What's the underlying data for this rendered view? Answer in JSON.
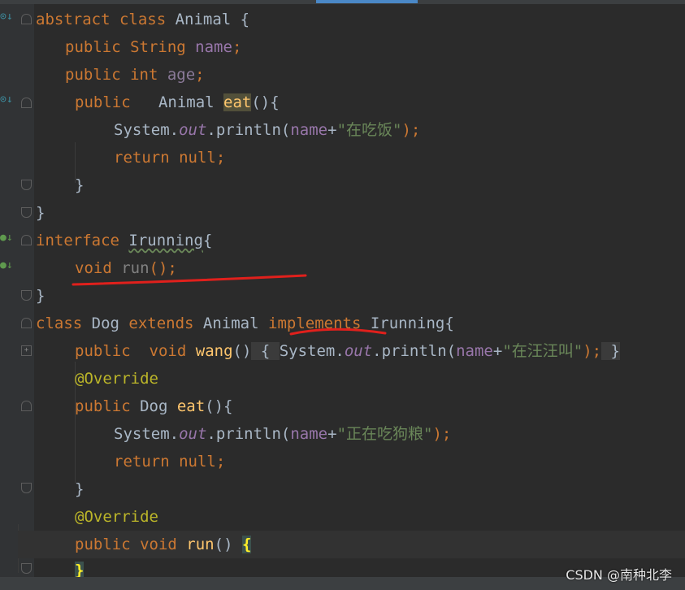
{
  "editor": {
    "lines": {
      "l1": [
        "abstract class",
        " Animal {"
      ],
      "l2": [
        "public String",
        " ",
        "name",
        ";"
      ],
      "l3": [
        "public int",
        " ",
        "age",
        ";"
      ],
      "l4": [
        "public",
        "   Animal ",
        "eat",
        "(){"
      ],
      "l5": [
        "System.",
        "out",
        ".println(",
        "name",
        "+",
        "\"在吃饭\"",
        ");"
      ],
      "l6": [
        "return null",
        ";"
      ],
      "l7": [
        "}"
      ],
      "l8": [
        "}"
      ],
      "l9": [
        "interface",
        " ",
        "Irunning",
        "{"
      ],
      "l10": [
        "void",
        " ",
        "run",
        "();"
      ],
      "l11": [
        "}"
      ],
      "l12": [
        "class",
        " Dog ",
        "extends",
        " Animal ",
        "implements",
        " Irunning{"
      ],
      "l13": [
        "public",
        "  ",
        "void",
        " ",
        "wang",
        "()",
        " { ",
        "System.",
        "out",
        ".println(",
        "name",
        "+",
        "\"在汪汪叫\"",
        ");",
        " }"
      ],
      "l14": [
        "@Override"
      ],
      "l15": [
        "public",
        " Dog ",
        "eat",
        "(){"
      ],
      "l16": [
        "System.",
        "out",
        ".println(",
        "name",
        "+",
        "\"正在吃狗粮\"",
        ");"
      ],
      "l17": [
        "return null",
        ";"
      ],
      "l18": [
        "}"
      ],
      "l19": [
        "@Override"
      ],
      "l20": [
        "public void",
        " ",
        "run",
        "() ",
        "{"
      ],
      "l21": [
        "}"
      ]
    }
  },
  "watermark": "CSDN @南种北李",
  "colors": {
    "background": "#2b2b2b",
    "keyword": "#cc7832",
    "method": "#ffc66d",
    "field": "#9876aa",
    "string": "#6a8759",
    "annotation": "#bbb529",
    "underline_mark": "#e0201c"
  },
  "icons": [
    "implemented-up-icon",
    "overridden-icon",
    "implementation-down-icon",
    "fold-icon"
  ]
}
